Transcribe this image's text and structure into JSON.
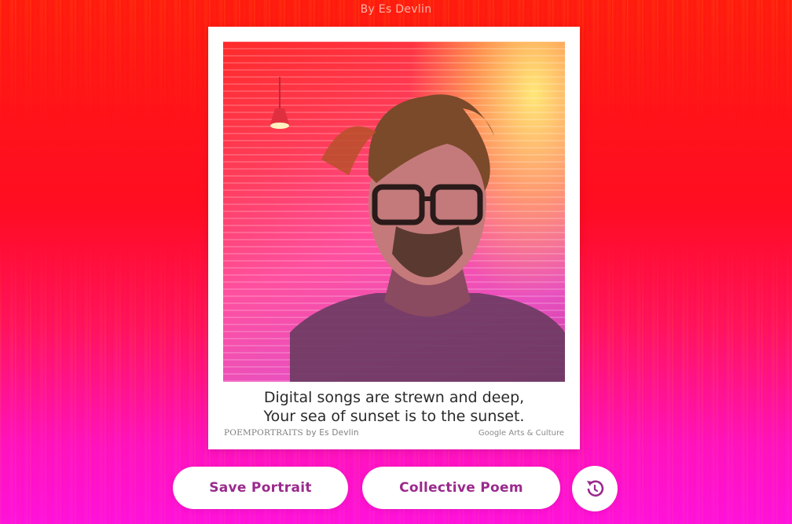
{
  "header": {
    "byline": "By Es Devlin"
  },
  "portrait": {
    "image_alt": "Portrait photo of a man with messy hair and glasses, tinted in red, pink and yellow, overlaid with poem text",
    "poem_line_1": "Digital songs are strewn and deep,",
    "poem_line_2": "Your sea of sunset is to the sunset.",
    "brand_poem": "POEMPORTRAITS",
    "brand_by": "by Es Devlin",
    "brand_google": "Google",
    "brand_arts": "Arts & Culture"
  },
  "actions": {
    "save_label": "Save Portrait",
    "collective_label": "Collective Poem",
    "reset_icon": "reset-icon"
  },
  "colors": {
    "accent_text": "#9a2a8c",
    "background_top": "#ff1a10",
    "background_bottom": "#ff10e0"
  }
}
